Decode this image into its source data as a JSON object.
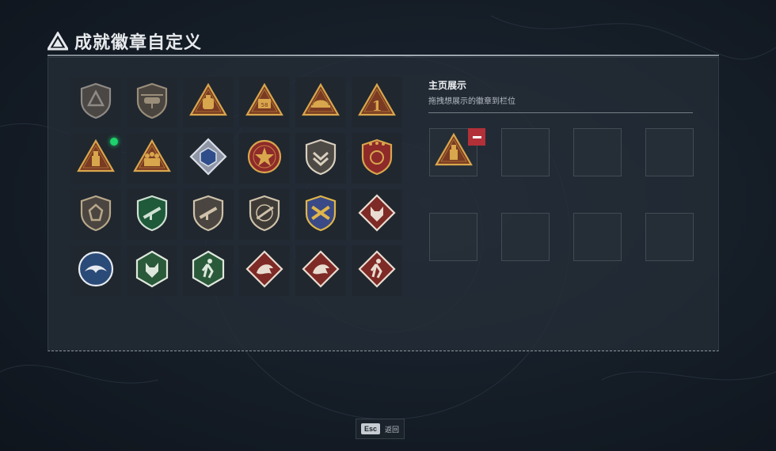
{
  "header": {
    "title": "成就徽章自定义",
    "logo_icon": "triangle-logo-icon"
  },
  "badges": [
    {
      "name": "shield-triangle-icon",
      "shape": "shield",
      "bg": "#4a4744",
      "fg": "#8e8a86",
      "emblem": "tri"
    },
    {
      "name": "helicopter-shield-icon",
      "shape": "shield",
      "bg": "#4b4540",
      "fg": "#9a8e7a",
      "emblem": "heli"
    },
    {
      "name": "bag-triangle-icon",
      "shape": "triangle",
      "bg": "#7a3b22",
      "fg": "#d8a64c",
      "emblem": "bag"
    },
    {
      "name": "crate-58-triangle-icon",
      "shape": "triangle",
      "bg": "#7a3b22",
      "fg": "#d8a64c",
      "emblem": "crate"
    },
    {
      "name": "helmet-triangle-icon",
      "shape": "triangle",
      "bg": "#7a3b22",
      "fg": "#d8a64c",
      "emblem": "helmet"
    },
    {
      "name": "number-one-triangle-icon",
      "shape": "triangle",
      "bg": "#7a3b22",
      "fg": "#d8a64c",
      "emblem": "one"
    },
    {
      "name": "ammo-triangle-icon",
      "shape": "triangle",
      "bg": "#7a3b22",
      "fg": "#d8a64c",
      "emblem": "ammo",
      "new": true
    },
    {
      "name": "soldiers-triangle-icon",
      "shape": "triangle",
      "bg": "#7a3b22",
      "fg": "#d8a64c",
      "emblem": "squad"
    },
    {
      "name": "blue-cube-diamond-icon",
      "shape": "diamond",
      "bg": "#8e96a6",
      "fg": "#d9dde6",
      "emblem": "cube"
    },
    {
      "name": "star-medal-icon",
      "shape": "medal",
      "bg": "#8e2a2a",
      "fg": "#d8a64c",
      "emblem": "star"
    },
    {
      "name": "chevron-shield-icon",
      "shape": "shield",
      "bg": "#4d4a45",
      "fg": "#d8cfbe",
      "emblem": "chev"
    },
    {
      "name": "stars-shield-icon",
      "shape": "shield",
      "bg": "#8e2a2a",
      "fg": "#d8a64c",
      "emblem": "stars"
    },
    {
      "name": "beast-shield-icon",
      "shape": "shield",
      "bg": "#4a4540",
      "fg": "#b8a88a",
      "emblem": "paw"
    },
    {
      "name": "green-rifle-shield-icon",
      "shape": "shield",
      "bg": "#1f5a3a",
      "fg": "#cfe1d3",
      "emblem": "rifle"
    },
    {
      "name": "rifle-shield-icon",
      "shape": "shield",
      "bg": "#4a4540",
      "fg": "#cfc2aa",
      "emblem": "rifle"
    },
    {
      "name": "sniper-shield-icon",
      "shape": "shield",
      "bg": "#3e3b37",
      "fg": "#cfc2aa",
      "emblem": "sniper"
    },
    {
      "name": "crossed-rifles-shield-icon",
      "shape": "shield",
      "bg": "#3a4a86",
      "fg": "#e0b64a",
      "emblem": "cross"
    },
    {
      "name": "wolf-diamond-icon",
      "shape": "diamond",
      "bg": "#7e2a26",
      "fg": "#e8dcd0",
      "emblem": "wolf"
    },
    {
      "name": "eagle-circle-icon",
      "shape": "circle",
      "bg": "#2a4a78",
      "fg": "#e6eaf0",
      "emblem": "eagle"
    },
    {
      "name": "green-wolf-hexagon-icon",
      "shape": "hexagon",
      "bg": "#2a5a3a",
      "fg": "#dfe8dd",
      "emblem": "wolf"
    },
    {
      "name": "green-runner-hexagon-icon",
      "shape": "hexagon",
      "bg": "#2a5a3a",
      "fg": "#dfe8dd",
      "emblem": "runner"
    },
    {
      "name": "dragon-diamond-icon",
      "shape": "diamond",
      "bg": "#7e2a26",
      "fg": "#e8dcd0",
      "emblem": "dragon"
    },
    {
      "name": "dragon-diamond-2-icon",
      "shape": "diamond",
      "bg": "#7e2a26",
      "fg": "#e8dcd0",
      "emblem": "dragon"
    },
    {
      "name": "runner-diamond-icon",
      "shape": "diamond",
      "bg": "#7e2a26",
      "fg": "#e8dcd0",
      "emblem": "runner"
    }
  ],
  "showcase": {
    "title": "主页展示",
    "description": "拖拽想展示的徽章到栏位",
    "slots": [
      {
        "badge": "ammo-triangle-icon",
        "filled": true
      },
      {
        "filled": false
      },
      {
        "filled": false
      },
      {
        "filled": false
      },
      {
        "filled": false
      },
      {
        "filled": false
      },
      {
        "filled": false
      },
      {
        "filled": false
      }
    ],
    "remove_icon": "minus-icon"
  },
  "footer": {
    "key": "Esc",
    "label": "返回"
  },
  "colors": {
    "accent_green": "#1dd36b",
    "remove_red": "#b23038"
  }
}
